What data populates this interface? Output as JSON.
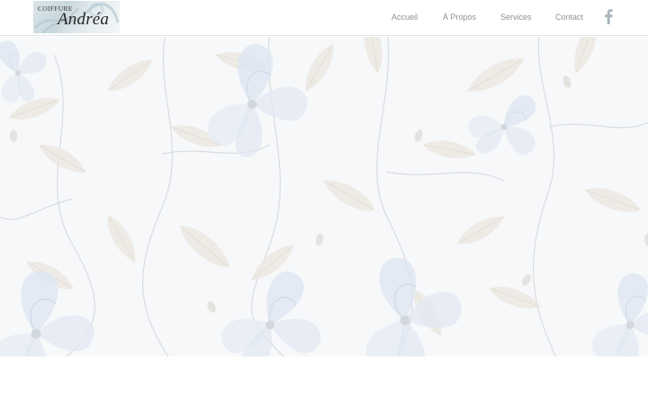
{
  "header": {
    "logo": {
      "line1": "COIFFURE",
      "line2": "Andréa"
    },
    "nav": [
      {
        "label": "Accueil"
      },
      {
        "label": "À Propos"
      },
      {
        "label": "Services"
      },
      {
        "label": "Contact"
      }
    ],
    "social": {
      "icon": "facebook-icon"
    }
  },
  "hero": {
    "background": "floral-watercolor-pattern"
  },
  "colors": {
    "nav_text": "#8f8f8f",
    "facebook_icon": "#a9b6bd",
    "flower_blue": "#dde6f2",
    "leaf_beige": "#ece9e2",
    "stem_gray": "#d6d9dd"
  }
}
